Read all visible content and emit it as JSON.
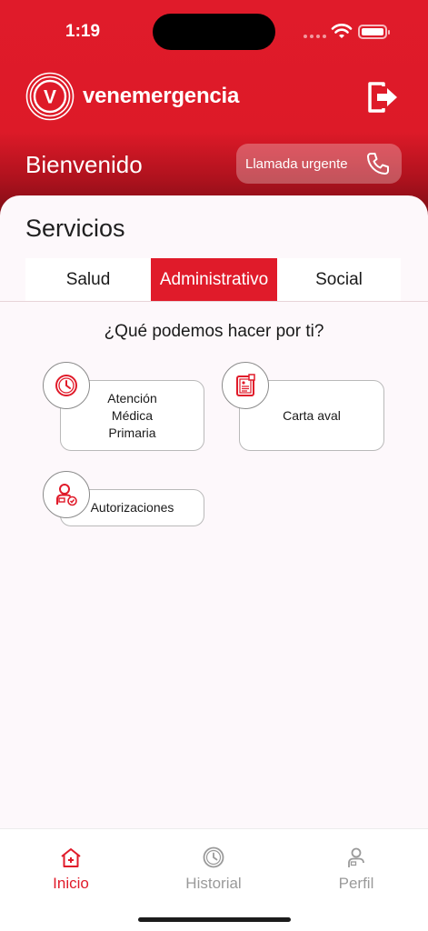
{
  "status_bar": {
    "time": "1:19"
  },
  "header": {
    "brand": "venemergencia",
    "logo_letter": "V",
    "welcome": "Bienvenido",
    "urgent_call_label": "Llamada urgente"
  },
  "services": {
    "title": "Servicios",
    "tabs": [
      {
        "label": "Salud",
        "active": false
      },
      {
        "label": "Administrativo",
        "active": true
      },
      {
        "label": "Social",
        "active": false
      }
    ],
    "question": "¿Qué podemos hacer por ti?",
    "cards": [
      {
        "label": "Atención\nMédica\nPrimaria",
        "icon": "clock-icon"
      },
      {
        "label": "Carta aval",
        "icon": "document-icon"
      },
      {
        "label": "Autorizaciones",
        "icon": "user-check-icon"
      }
    ]
  },
  "tabbar": {
    "items": [
      {
        "label": "Inicio",
        "icon": "home-icon",
        "active": true
      },
      {
        "label": "Historial",
        "icon": "clock-icon",
        "active": false
      },
      {
        "label": "Perfil",
        "icon": "user-icon",
        "active": false
      }
    ]
  },
  "colors": {
    "brand_red": "#e01b2a",
    "inactive_gray": "#9a9a9a"
  }
}
